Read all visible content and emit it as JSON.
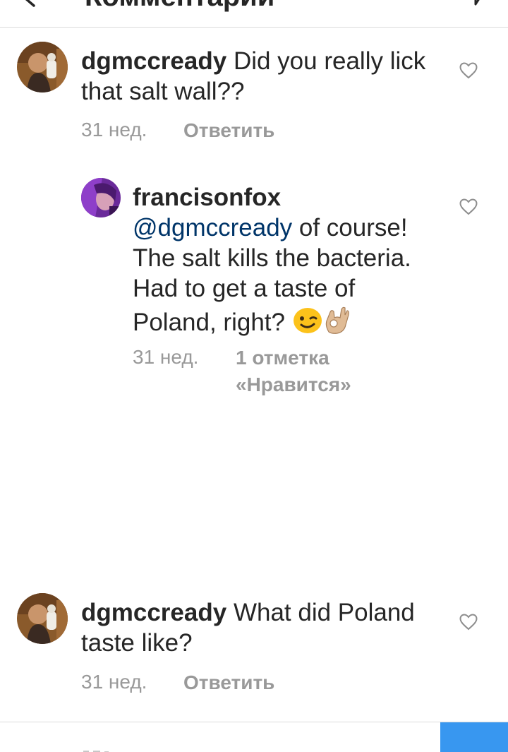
{
  "header": {
    "title": "Комментарии"
  },
  "comments": [
    {
      "username": "dgmccready",
      "text": " Did you really lick that salt wall??",
      "time": "31 нед.",
      "reply_label": "Ответить"
    },
    {
      "username": "francisonfox",
      "mention": "@dgmccready",
      "text": " of course! The salt kills the bacteria. Had to get a taste of Poland, right? ",
      "time": "31 нед.",
      "likes_label_line1": "1 отметка",
      "likes_label_line2": "«Нравится»"
    },
    {
      "username": "dgmccready",
      "text": " What did Poland taste like?",
      "time": "31 нед.",
      "reply_label": "Ответить"
    }
  ],
  "colors": {
    "mention": "#003569",
    "meta": "#999999",
    "post_button": "#3897f0"
  }
}
